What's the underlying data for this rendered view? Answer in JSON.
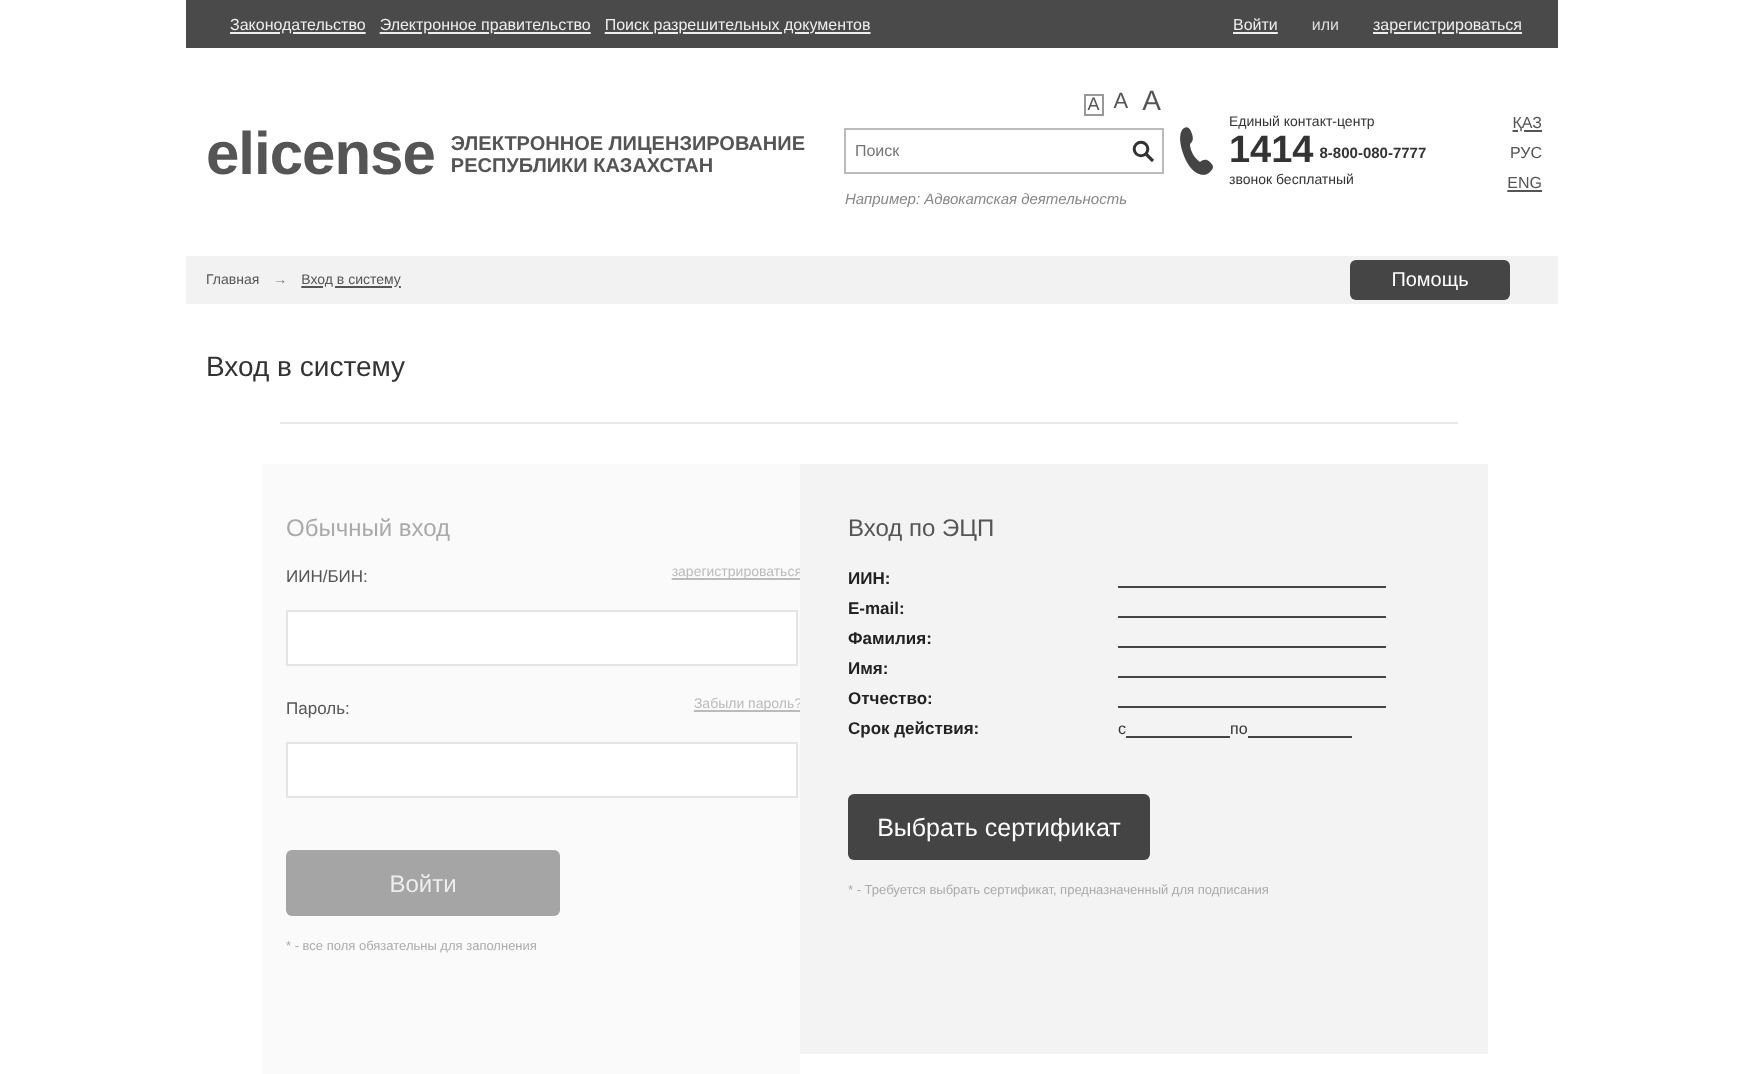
{
  "top_bar": {
    "links": [
      "Законодательство",
      "Электронное правительство",
      "Поиск разрешительных документов"
    ],
    "login": "Войти",
    "or": "или",
    "register": "зарегистрироваться"
  },
  "header": {
    "logo": "elicense",
    "tagline": [
      "ЭЛЕКТРОННОЕ ЛИЦЕНЗИРОВАНИЕ",
      "РЕСПУБЛИКИ КАЗАХСТАН"
    ],
    "font_sizes": [
      {
        "label": "A",
        "selected": true
      },
      {
        "label": "A",
        "selected": false
      },
      {
        "label": "A",
        "selected": false
      }
    ],
    "search": {
      "placeholder": "Поиск",
      "example": "Например: Адвокатская деятельность"
    },
    "contact": {
      "title": "Единый контакт-центр",
      "short_number": "1414",
      "phone": "8-800-080-7777",
      "note": "звонок бесплатный"
    },
    "languages": [
      {
        "label": "ҚАЗ",
        "selected": false
      },
      {
        "label": "РУС",
        "selected": true
      },
      {
        "label": "ENG",
        "selected": false
      }
    ]
  },
  "breadcrumb": {
    "items": [
      "Главная",
      "Вход в систему"
    ],
    "separator": "→",
    "help_button": "Помощь"
  },
  "page_title": "Вход в систему",
  "regular_login": {
    "title": "Обычный вход",
    "fields": [
      {
        "label": "ИИН/БИН:",
        "link": "зарегистрироваться"
      },
      {
        "label": "Пароль:",
        "link": "Забыли пароль?"
      }
    ],
    "button": "Войти",
    "button_disabled": true,
    "note": "* - все поля обязательны для заполнения"
  },
  "eds_login": {
    "title": "Вход по ЭЦП",
    "fields": [
      {
        "label": "ИИН:",
        "kind": "line"
      },
      {
        "label": "E-mail:",
        "kind": "line"
      },
      {
        "label": "Фамилия:",
        "kind": "line"
      },
      {
        "label": "Имя:",
        "kind": "line"
      },
      {
        "label": "Отчество:",
        "kind": "line"
      },
      {
        "label": "Срок действия:",
        "kind": "range",
        "from": "с",
        "to": "по"
      }
    ],
    "button": "Выбрать сертификат",
    "note": "* - Требуется выбрать сертификат, предназначенный для подписания"
  }
}
